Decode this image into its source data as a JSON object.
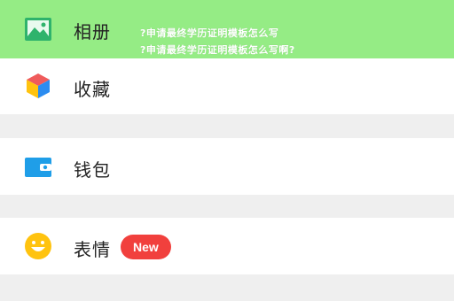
{
  "menu": {
    "items": [
      {
        "label": "相册",
        "icon": "photo-album-icon",
        "highlighted": true
      },
      {
        "label": "收藏",
        "icon": "cube-favorites-icon"
      },
      {
        "label": "钱包",
        "icon": "wallet-icon"
      },
      {
        "label": "表情",
        "icon": "smiley-face-icon",
        "badge": "New"
      }
    ]
  },
  "overlay": {
    "line1": "?申请最终学历证明模板怎么写",
    "line2": "?申请最终学历证明模板怎么写啊?"
  },
  "colors": {
    "highlight": "#95ec85",
    "badge": "#f1403d",
    "album_icon": "#2fb36c",
    "wallet_icon": "#1f9ee8",
    "smiley_icon": "#ffc30f"
  }
}
